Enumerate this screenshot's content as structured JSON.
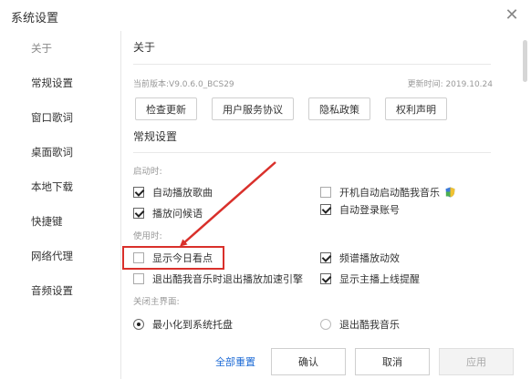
{
  "window": {
    "title": "系统设置"
  },
  "sidebar": {
    "items": [
      {
        "label": "关于"
      },
      {
        "label": "常规设置"
      },
      {
        "label": "窗口歌词"
      },
      {
        "label": "桌面歌词"
      },
      {
        "label": "本地下载"
      },
      {
        "label": "快捷键"
      },
      {
        "label": "网络代理"
      },
      {
        "label": "音频设置"
      }
    ]
  },
  "about": {
    "title": "关于",
    "version": "当前版本:V9.0.6.0_BCS29",
    "update_time": "更新时间: 2019.10.24",
    "buttons": {
      "check_update": "检查更新",
      "user_agreement": "用户服务协议",
      "privacy": "隐私政策",
      "copyright": "权利声明"
    }
  },
  "general": {
    "title": "常规设置",
    "startup_label": "启动时:",
    "startup": {
      "auto_play": {
        "label": "自动播放歌曲",
        "checked": true
      },
      "auto_start": {
        "label": "开机自动启动酷我音乐",
        "checked": false
      },
      "greeting": {
        "label": "播放问候语",
        "checked": true
      },
      "auto_login": {
        "label": "自动登录账号",
        "checked": true
      }
    },
    "usage_label": "使用时:",
    "usage": {
      "today": {
        "label": "显示今日看点",
        "checked": false
      },
      "spectrum": {
        "label": "频谱播放动效",
        "checked": true
      },
      "exit_accel": {
        "label": "退出酷我音乐时退出播放加速引擎",
        "checked": false
      },
      "live_remind": {
        "label": "显示主播上线提醒",
        "checked": true
      }
    },
    "close_label": "关闭主界面:",
    "close": {
      "minimize": {
        "label": "最小化到系统托盘",
        "checked": true
      },
      "exit": {
        "label": "退出酷我音乐",
        "checked": false
      }
    }
  },
  "footer": {
    "reset": "全部重置",
    "confirm": "确认",
    "cancel": "取消",
    "apply": "应用"
  },
  "colors": {
    "highlight": "#d9302b",
    "link": "#1e6bd6"
  }
}
